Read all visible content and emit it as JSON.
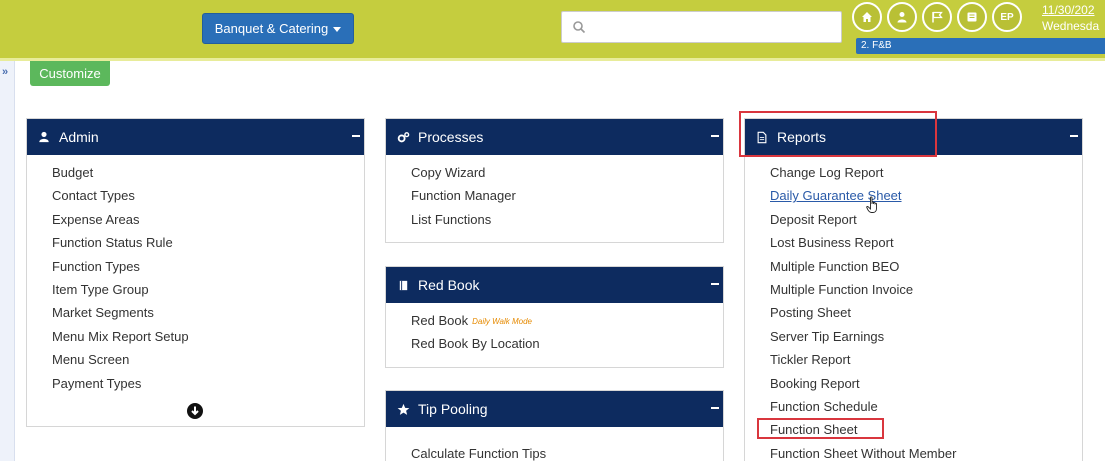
{
  "header": {
    "module_label": "Banquet & Catering",
    "search_placeholder": "",
    "icon_ep_label": "EP",
    "date": "11/30/202",
    "weekday": "Wednesda",
    "dept_label": "2. F&B"
  },
  "toolbar": {
    "customize_label": "Customize"
  },
  "panels": {
    "admin": {
      "title": "Admin",
      "items": [
        "Budget",
        "Contact Types",
        "Expense Areas",
        "Function Status Rule",
        "Function Types",
        "Item Type Group",
        "Market Segments",
        "Menu Mix Report Setup",
        "Menu Screen",
        "Payment Types"
      ]
    },
    "processes": {
      "title": "Processes",
      "items": [
        "Copy Wizard",
        "Function Manager",
        "List Functions"
      ]
    },
    "redbook": {
      "title": "Red Book",
      "items": [
        "Red Book",
        "Red Book By Location"
      ],
      "tag": "Daily Walk Mode"
    },
    "tippooling": {
      "title": "Tip Pooling",
      "items": [
        "Calculate Function Tips"
      ]
    },
    "reports": {
      "title": "Reports",
      "items": [
        "Change Log Report",
        "Daily Guarantee Sheet",
        "Deposit Report",
        "Lost Business Report",
        "Multiple Function BEO",
        "Multiple Function Invoice",
        "Posting Sheet",
        "Server Tip Earnings",
        "Tickler Report",
        "Booking Report",
        "Function Schedule",
        "Function Sheet",
        "Function Sheet Without Member"
      ]
    }
  },
  "colors": {
    "header_bg": "#c5cd3e",
    "panel_head": "#0d2b5f",
    "accent_blue": "#2a6fb8",
    "highlight_red": "#d9363e",
    "customize_green": "#5cb85c"
  }
}
